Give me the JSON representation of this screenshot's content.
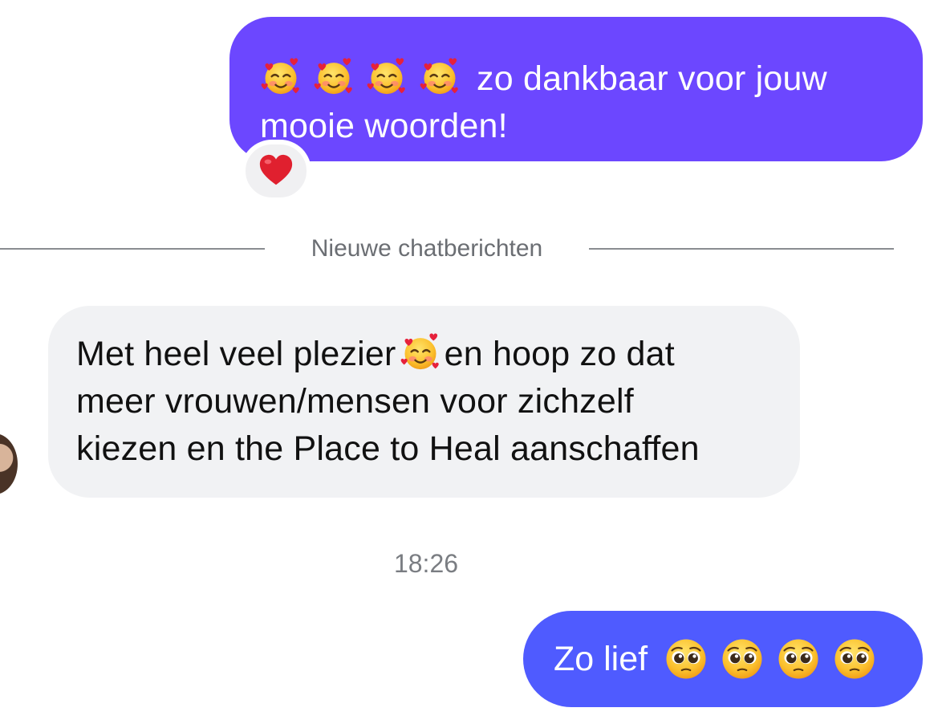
{
  "messages": [
    {
      "direction": "outgoing",
      "emoji_prefix": [
        "smiling-face-with-hearts",
        "smiling-face-with-hearts",
        "smiling-face-with-hearts",
        "smiling-face-with-hearts"
      ],
      "line1": "zo dankbaar voor jouw",
      "line2": "mooie woorden!",
      "reaction": "red-heart",
      "bubble_color": "#6c47ff"
    }
  ],
  "divider": {
    "label": "Nieuwe chatberichten"
  },
  "incoming": {
    "line1_part1": "Met heel veel plezier",
    "line1_emoji": "smiling-face-with-hearts",
    "line1_part2": "en hoop zo dat",
    "line2": "meer vrouwen/mensen voor zichzelf",
    "line3": "kiezen en the Place to Heal aanschaffen",
    "bubble_color": "#f1f2f4"
  },
  "timestamp": "18:26",
  "reply": {
    "text": "Zo lief",
    "emoji_suffix": [
      "pleading-face",
      "pleading-face",
      "pleading-face",
      "pleading-face"
    ],
    "bubble_color": "#4f5bff"
  }
}
